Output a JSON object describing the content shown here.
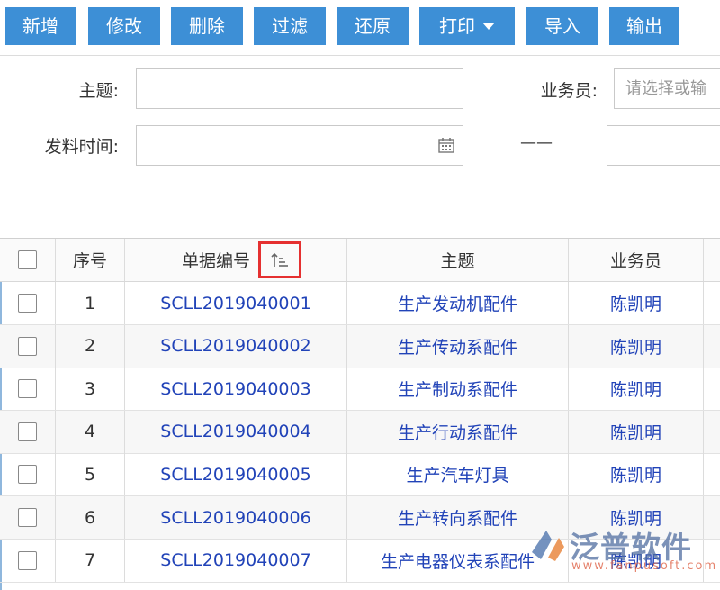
{
  "toolbar": {
    "buttons": [
      {
        "label": "新增"
      },
      {
        "label": "修改"
      },
      {
        "label": "删除"
      },
      {
        "label": "过滤"
      },
      {
        "label": "还原"
      },
      {
        "label": "打印"
      },
      {
        "label": "导入"
      },
      {
        "label": "输出"
      }
    ]
  },
  "form": {
    "subject_label": "主题:",
    "subject_value": "",
    "salesman_label": "业务员:",
    "salesman_placeholder": "请选择或输",
    "date_label": "发料时间:",
    "date_from": "",
    "date_separator": "——",
    "date_to": ""
  },
  "table": {
    "headers": [
      "序号",
      "单据编号",
      "主题",
      "业务员"
    ],
    "rows": [
      {
        "index": "1",
        "doc_no": "SCLL2019040001",
        "subject": "生产发动机配件",
        "salesman": "陈凯明"
      },
      {
        "index": "2",
        "doc_no": "SCLL2019040002",
        "subject": "生产传动系配件",
        "salesman": "陈凯明"
      },
      {
        "index": "3",
        "doc_no": "SCLL2019040003",
        "subject": "生产制动系配件",
        "salesman": "陈凯明"
      },
      {
        "index": "4",
        "doc_no": "SCLL2019040004",
        "subject": "生产行动系配件",
        "salesman": "陈凯明"
      },
      {
        "index": "5",
        "doc_no": "SCLL2019040005",
        "subject": "生产汽车灯具",
        "salesman": "陈凯明"
      },
      {
        "index": "6",
        "doc_no": "SCLL2019040006",
        "subject": "生产转向系配件",
        "salesman": "陈凯明"
      },
      {
        "index": "7",
        "doc_no": "SCLL2019040007",
        "subject": "生产电器仪表系配件",
        "salesman": "陈凯明"
      }
    ]
  },
  "watermark": {
    "brand": "泛普软件",
    "url": "www.fanpusoft.com"
  },
  "colors": {
    "button_bg": "#3d8fd6",
    "link_text": "#2143b8",
    "highlight_box": "#e53030"
  },
  "icons": {
    "calendar": "calendar-icon",
    "sort": "sort-ascending-icon",
    "dropdown": "caret-down-icon"
  }
}
